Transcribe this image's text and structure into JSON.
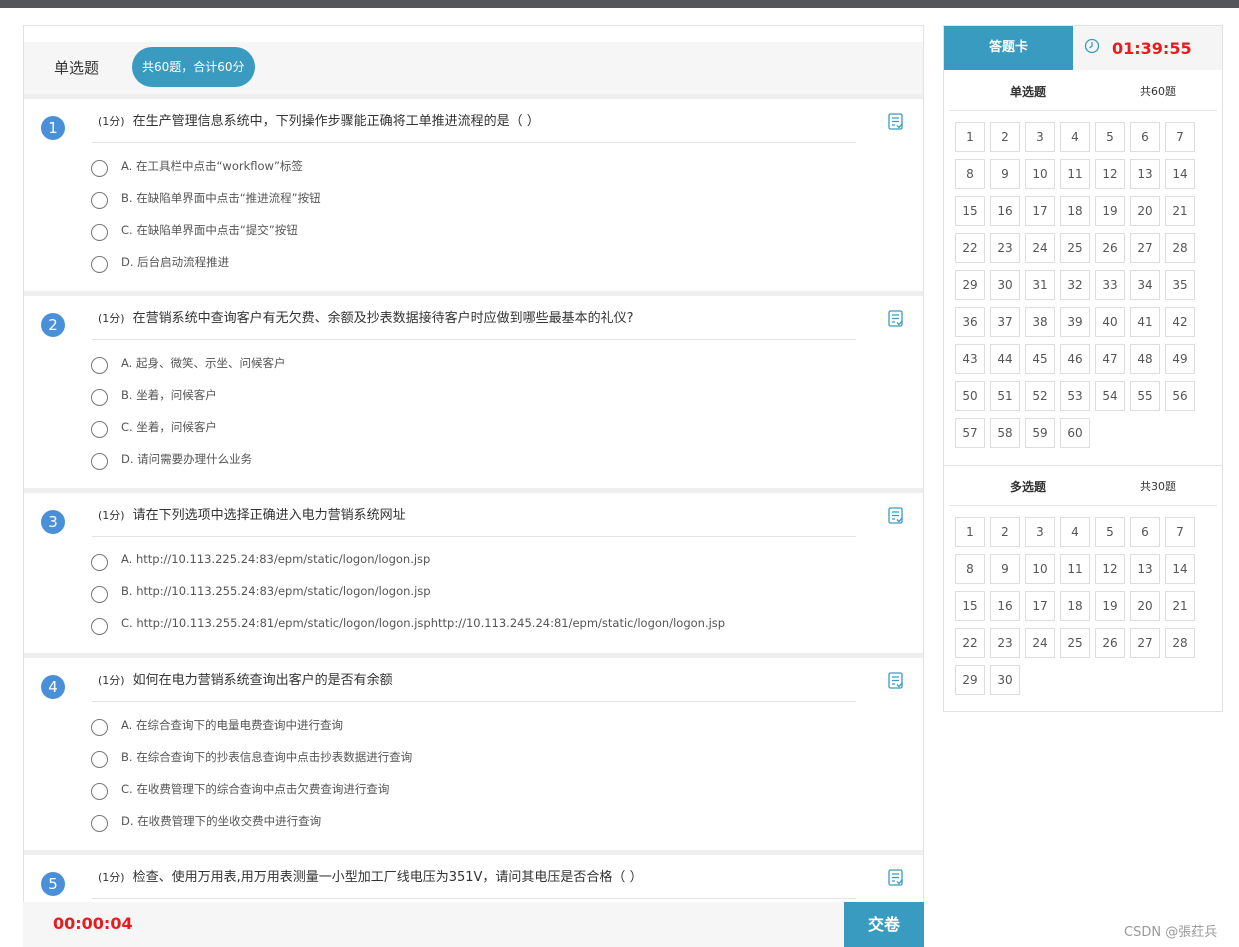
{
  "colors": {
    "accent": "#3a9bc1",
    "timer": "#e81c1c",
    "number_badge": "#4a90d9"
  },
  "section": {
    "title": "单选题",
    "count": "共60题，合计60分"
  },
  "questions": [
    {
      "num": "1",
      "score": "(1分)",
      "text": "在生产管理信息系统中，下列操作步骤能正确将工单推进流程的是（  ）",
      "options": [
        "A. 在工具栏中点击“workflow”标签",
        "B. 在缺陷单界面中点击“推进流程”按钮",
        "C. 在缺陷单界面中点击“提交”按钮",
        "D. 后台启动流程推进"
      ]
    },
    {
      "num": "2",
      "score": "(1分)",
      "text": "在营销系统中查询客户有无欠费、余额及抄表数据接待客户时应做到哪些最基本的礼仪?",
      "options": [
        "A. 起身、微笑、示坐、问候客户",
        "B. 坐着，问候客户",
        "C. 坐着，问候客户",
        "D. 请问需要办理什么业务"
      ]
    },
    {
      "num": "3",
      "score": "(1分)",
      "text": "请在下列选项中选择正确进入电力营销系统网址",
      "options": [
        "A. http://10.113.225.24:83/epm/static/logon/logon.jsp",
        "B. http://10.113.255.24:83/epm/static/logon/logon.jsp",
        "C. http://10.113.255.24:81/epm/static/logon/logon.jsphttp://10.113.245.24:81/epm/static/logon/logon.jsp"
      ]
    },
    {
      "num": "4",
      "score": "(1分)",
      "text": "如何在电力营销系统查询出客户的是否有余额",
      "options": [
        "A. 在综合查询下的电量电费查询中进行查询",
        "B. 在综合查询下的抄表信息查询中点击抄表数据进行查询",
        "C. 在收费管理下的综合查询中点击欠费查询进行查询",
        "D. 在收费管理下的坐收交费中进行查询"
      ]
    },
    {
      "num": "5",
      "score": "(1分)",
      "text": "检查、使用万用表,用万用表测量一小型加工厂线电压为351V，请问其电压是否合格（  ）",
      "options": []
    }
  ],
  "bottom": {
    "elapsed": "00:00:04",
    "submit": "交卷"
  },
  "card": {
    "tab": "答题卡",
    "countdown": "01:39:55",
    "groups": [
      {
        "name": "单选题",
        "count": "共60题",
        "total": 60
      },
      {
        "name": "多选题",
        "count": "共30题",
        "total": 30
      }
    ]
  },
  "watermark": "CSDN @張荭兵"
}
